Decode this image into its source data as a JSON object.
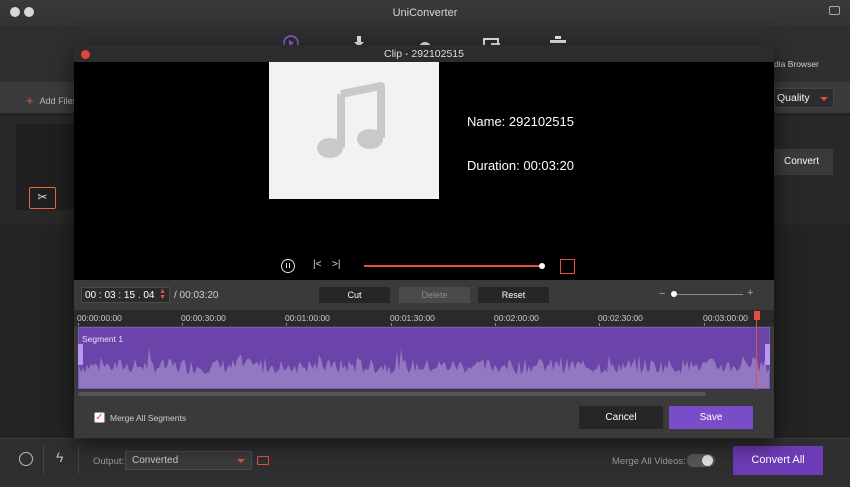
{
  "app": {
    "title": "UniConverter",
    "media_browser_label": "dia Browser",
    "add_files_label": "Add Files",
    "quality_label": "Quality",
    "convert_label": "Convert",
    "toolbar_icons": [
      "convert-icon",
      "download-icon",
      "record-icon",
      "transfer-icon",
      "toolbox-icon"
    ]
  },
  "dialog": {
    "title": "Clip - 292102515",
    "name_text": "Name: 292102515",
    "duration_text": "Duration: 00:03:20",
    "playback_progress": 1.0,
    "timecode": "00 : 03 : 15 . 04",
    "total_time": "/ 00:03:20",
    "buttons": {
      "cut": "Cut",
      "delete": "Delete",
      "reset": "Reset",
      "cancel": "Cancel",
      "save": "Save"
    },
    "ruler_labels": [
      "00:00:00:00",
      "00:00:30:00",
      "00:01:00:00",
      "00:01:30:00",
      "00:02:00:00",
      "00:02:30:00",
      "00:03:00:00"
    ],
    "segment_label": "Segment 1",
    "merge_segments_label": "Merge All Segments",
    "merge_segments_checked": true,
    "zoom_level": 0.0
  },
  "footer": {
    "output_label": "Output:",
    "output_value": "Converted",
    "merge_videos_label": "Merge All Videos:",
    "merge_videos_on": false,
    "convert_all_label": "Convert All"
  },
  "colors": {
    "accent": "#e2503e",
    "purple": "#6c3bb5",
    "waveform": "#9f89c8"
  }
}
